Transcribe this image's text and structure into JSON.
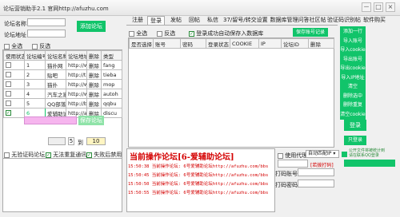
{
  "window": {
    "title": "论坛营销助手2.1 官网http://afuzhu.com",
    "min_glyph": "－",
    "max_glyph": "□",
    "close_glyph": "×"
  },
  "left": {
    "forum_name_label": "论坛名称",
    "forum_url_label": "论坛地址",
    "add_button": "添加论坛",
    "select_all": "全选",
    "invert": "反选",
    "table": {
      "headers": [
        "使用状态",
        "论坛编号",
        "论坛名称",
        "论坛地址",
        "删除",
        "类型"
      ],
      "rows": [
        {
          "checked": false,
          "id": "1",
          "name": "猫扑网",
          "url": "http://w",
          "del": "删除",
          "type": "fang"
        },
        {
          "checked": false,
          "id": "2",
          "name": "贴吧",
          "url": "http://tie",
          "del": "删除",
          "type": "tieba"
        },
        {
          "checked": false,
          "id": "3",
          "name": "猫扑",
          "url": "http://w",
          "del": "删除",
          "type": "mop"
        },
        {
          "checked": false,
          "id": "4",
          "name": "汽车之家",
          "url": "http://ww",
          "del": "删除",
          "type": "autoh"
        },
        {
          "checked": false,
          "id": "5",
          "name": "QQ部落",
          "url": "http://bu",
          "del": "删除",
          "type": "qqbu"
        },
        {
          "checked": true,
          "id": "6",
          "name": "爱辅助论坛",
          "url": "http://afu",
          "del": "删除",
          "type": "discu"
        }
      ]
    },
    "save_button": "保存论坛",
    "interval_label": "到",
    "interval_from": "5",
    "interval_to": "10"
  },
  "tabs": [
    "注册",
    "登录",
    "发帖",
    "回帖",
    "私信",
    "37/留号/转交设置",
    "数据库管理",
    "问答社区帖",
    "验证码识别帖",
    "软件购买"
  ],
  "right": {
    "select_all": "全选",
    "invert": "反选",
    "save_login_check": "登录成功自动保存入数据库",
    "save_account_button": "保存账号记录",
    "table_headers": [
      "是否选择",
      "账号",
      "密码",
      "登录状态",
      "COOKIE",
      "IP",
      "论坛ID",
      "删除"
    ],
    "side_buttons": [
      "添加一行",
      "导入账号",
      "导入cookie",
      "导出账号",
      "导出cookie",
      "导入IP地址",
      "清空",
      "删除选中",
      "删除重复",
      "清空cookie"
    ],
    "login_button": "登录",
    "batch_login_button": "只登录"
  },
  "bottom": {
    "opt1": "无验证码论坛",
    "opt2": "无法重复通讯",
    "opt3": "失败后禁用",
    "log_title": "当前操作论坛[6-爱辅助论坛]",
    "log_lines": [
      "15:50:38 当前操作论坛: 6号爱辅助论坛http://afuzhu.com/bbs",
      "15:50:45 当前操作论坛: 6号爱辅助论坛http://afuzhu.com/bbs",
      "15:50:50 当前操作论坛: 6号爱辅助论坛http://afuzhu.com/bbs",
      "15:50:55 当前操作论坛: 6号爱辅助论坛http://afuzhu.com/bbs"
    ],
    "proxy_check": "使用代理IP",
    "auto_select": "自动匹配IP",
    "auto_dial": "[若拨打码]",
    "code_account_label": "打码账号",
    "code_password_label": "打码密码",
    "note": "公开文件将被统计到\n请在联系QQ登录"
  },
  "colors": {
    "accent": "#11c46a",
    "pink": "#f6b5ee",
    "log_red": "#d40000"
  }
}
